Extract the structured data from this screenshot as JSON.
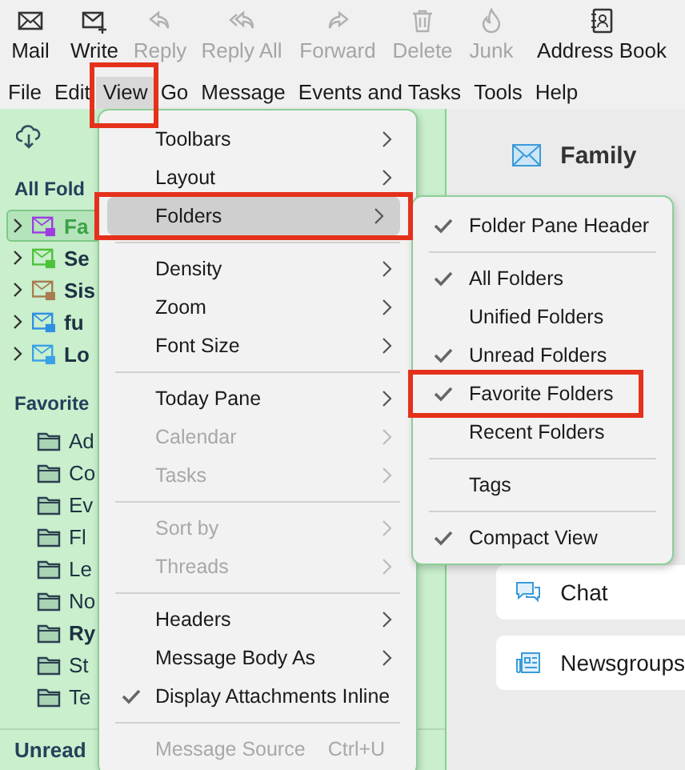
{
  "toolbar": [
    {
      "label": "Mail",
      "disabled": false
    },
    {
      "label": "Write",
      "disabled": false
    },
    {
      "label": "Reply",
      "disabled": true
    },
    {
      "label": "Reply All",
      "disabled": true
    },
    {
      "label": "Forward",
      "disabled": true
    },
    {
      "label": "Delete",
      "disabled": true
    },
    {
      "label": "Junk",
      "disabled": true
    },
    {
      "label": "Address Book",
      "disabled": false
    }
  ],
  "menubar": [
    {
      "label": "File",
      "selected": false,
      "highlighted": false
    },
    {
      "label": "Edit",
      "selected": false,
      "highlighted": false
    },
    {
      "label": "View",
      "selected": true,
      "highlighted": true
    },
    {
      "label": "Go",
      "selected": false,
      "highlighted": false
    },
    {
      "label": "Message",
      "selected": false,
      "highlighted": false
    },
    {
      "label": "Events and Tasks",
      "selected": false,
      "highlighted": false
    },
    {
      "label": "Tools",
      "selected": false,
      "highlighted": false
    },
    {
      "label": "Help",
      "selected": false,
      "highlighted": false
    }
  ],
  "folder_pane": {
    "all_heading": "All Fold",
    "accounts": [
      {
        "name": "Fa",
        "color": "#9b3de0",
        "selected": true
      },
      {
        "name": "Se",
        "color": "#4ec13a",
        "selected": false
      },
      {
        "name": "Sis",
        "color": "#a87b50",
        "selected": false
      },
      {
        "name": "fu",
        "color": "#2f8fe3",
        "selected": false
      },
      {
        "name": "Lo",
        "color": "#3aa0e8",
        "selected": false
      }
    ],
    "favorite_heading": "Favorite",
    "favorites": [
      {
        "name": "Ad",
        "bold": false
      },
      {
        "name": "Co",
        "bold": false
      },
      {
        "name": "Ev",
        "bold": false
      },
      {
        "name": "Fl",
        "bold": false
      },
      {
        "name": "Le",
        "bold": false
      },
      {
        "name": "No",
        "bold": false
      },
      {
        "name": "Ry",
        "bold": true
      },
      {
        "name": "St",
        "bold": false
      },
      {
        "name": "Te",
        "bold": false
      }
    ],
    "unread_heading": "Unread"
  },
  "main_pane": {
    "title": "Family",
    "cards": [
      "Chat",
      "Newsgroups"
    ]
  },
  "view_menu": [
    {
      "kind": "item",
      "label": "Toolbars",
      "submenu": true,
      "disabled": false,
      "checked": false,
      "selected": false,
      "highlighted": false
    },
    {
      "kind": "item",
      "label": "Layout",
      "submenu": true,
      "disabled": false,
      "checked": false,
      "selected": false,
      "highlighted": false
    },
    {
      "kind": "item",
      "label": "Folders",
      "submenu": true,
      "disabled": false,
      "checked": false,
      "selected": true,
      "highlighted": true
    },
    {
      "kind": "separator"
    },
    {
      "kind": "item",
      "label": "Density",
      "submenu": true,
      "disabled": false,
      "checked": false,
      "selected": false,
      "highlighted": false
    },
    {
      "kind": "item",
      "label": "Zoom",
      "submenu": true,
      "disabled": false,
      "checked": false,
      "selected": false,
      "highlighted": false
    },
    {
      "kind": "item",
      "label": "Font Size",
      "submenu": true,
      "disabled": false,
      "checked": false,
      "selected": false,
      "highlighted": false
    },
    {
      "kind": "separator"
    },
    {
      "kind": "item",
      "label": "Today Pane",
      "submenu": true,
      "disabled": false,
      "checked": false,
      "selected": false,
      "highlighted": false
    },
    {
      "kind": "item",
      "label": "Calendar",
      "submenu": true,
      "disabled": true,
      "checked": false,
      "selected": false,
      "highlighted": false
    },
    {
      "kind": "item",
      "label": "Tasks",
      "submenu": true,
      "disabled": true,
      "checked": false,
      "selected": false,
      "highlighted": false
    },
    {
      "kind": "separator"
    },
    {
      "kind": "item",
      "label": "Sort by",
      "submenu": true,
      "disabled": true,
      "checked": false,
      "selected": false,
      "highlighted": false
    },
    {
      "kind": "item",
      "label": "Threads",
      "submenu": true,
      "disabled": true,
      "checked": false,
      "selected": false,
      "highlighted": false
    },
    {
      "kind": "separator"
    },
    {
      "kind": "item",
      "label": "Headers",
      "submenu": true,
      "disabled": false,
      "checked": false,
      "selected": false,
      "highlighted": false
    },
    {
      "kind": "item",
      "label": "Message Body As",
      "submenu": true,
      "disabled": false,
      "checked": false,
      "selected": false,
      "highlighted": false
    },
    {
      "kind": "item",
      "label": "Display Attachments Inline",
      "submenu": false,
      "disabled": false,
      "checked": true,
      "selected": false,
      "highlighted": false
    },
    {
      "kind": "separator"
    },
    {
      "kind": "item",
      "label": "Message Source",
      "shortcut": "Ctrl+U",
      "submenu": false,
      "disabled": true,
      "checked": false,
      "selected": false,
      "highlighted": false
    }
  ],
  "folders_submenu": [
    {
      "kind": "item",
      "label": "Folder Pane Header",
      "checked": true,
      "highlighted": false
    },
    {
      "kind": "separator"
    },
    {
      "kind": "item",
      "label": "All Folders",
      "checked": true,
      "highlighted": false
    },
    {
      "kind": "item",
      "label": "Unified Folders",
      "checked": false,
      "highlighted": false
    },
    {
      "kind": "item",
      "label": "Unread Folders",
      "checked": true,
      "highlighted": false
    },
    {
      "kind": "item",
      "label": "Favorite Folders",
      "checked": true,
      "highlighted": true
    },
    {
      "kind": "item",
      "label": "Recent Folders",
      "checked": false,
      "highlighted": false
    },
    {
      "kind": "separator"
    },
    {
      "kind": "item",
      "label": "Tags",
      "checked": false,
      "highlighted": false
    },
    {
      "kind": "separator"
    },
    {
      "kind": "item",
      "label": "Compact View",
      "checked": true,
      "highlighted": false
    }
  ]
}
